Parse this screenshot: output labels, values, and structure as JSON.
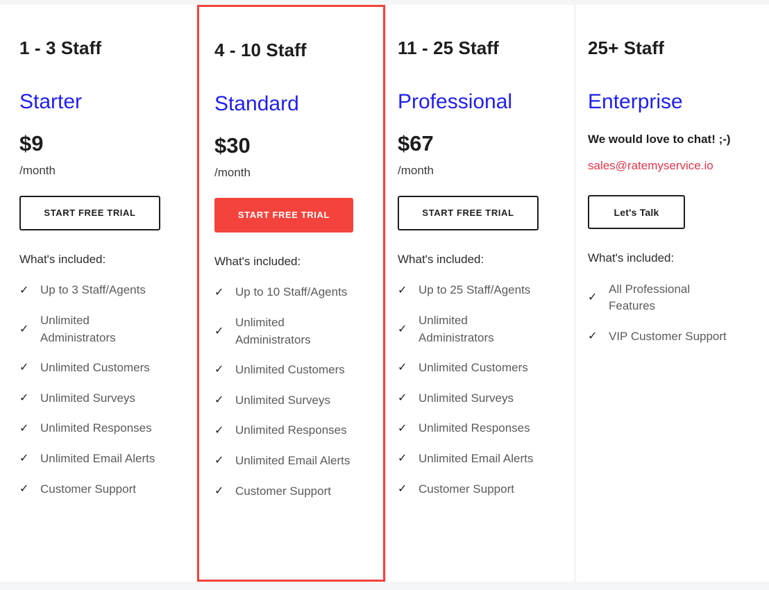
{
  "theme": {
    "accent_blue": "#1f1fef",
    "accent_red": "#f4433c",
    "email_red": "#e0354a",
    "text_dark": "#1d1d1f",
    "text_muted": "#5b5b5e",
    "page_background": "#f4f5f7",
    "card_background": "#ffffff",
    "divider": "#e3e4e8"
  },
  "icons": {
    "check": "✓"
  },
  "plans": [
    {
      "staff_range": "1 - 3 Staff",
      "name": "Starter",
      "price": "$9",
      "period": "/month",
      "cta_label": "START FREE TRIAL",
      "included_label": "What's included:",
      "features": [
        "Up to 3 Staff/Agents",
        "Unlimited Administrators",
        "Unlimited Customers",
        "Unlimited Surveys",
        "Unlimited Responses",
        "Unlimited Email Alerts",
        "Customer Support"
      ]
    },
    {
      "staff_range": "4 - 10 Staff",
      "name": "Standard",
      "price": "$30",
      "period": "/month",
      "cta_label": "START FREE TRIAL",
      "included_label": "What's included:",
      "features": [
        "Up to 10 Staff/Agents",
        "Unlimited Administrators",
        "Unlimited Customers",
        "Unlimited Surveys",
        "Unlimited Responses",
        "Unlimited Email Alerts",
        "Customer Support"
      ]
    },
    {
      "staff_range": "11 - 25 Staff",
      "name": "Professional",
      "price": "$67",
      "period": "/month",
      "cta_label": "START FREE TRIAL",
      "included_label": "What's included:",
      "features": [
        "Up to 25 Staff/Agents",
        "Unlimited Administrators",
        "Unlimited Customers",
        "Unlimited Surveys",
        "Unlimited Responses",
        "Unlimited Email Alerts",
        "Customer Support"
      ]
    },
    {
      "staff_range": "25+ Staff",
      "name": "Enterprise",
      "contact_line": "We would love to chat! ;-)",
      "contact_email": "sales@ratemyservice.io",
      "cta_label": "Let's Talk",
      "included_label": "What's included:",
      "features": [
        "All Professional Features",
        "VIP Customer Support"
      ]
    }
  ]
}
